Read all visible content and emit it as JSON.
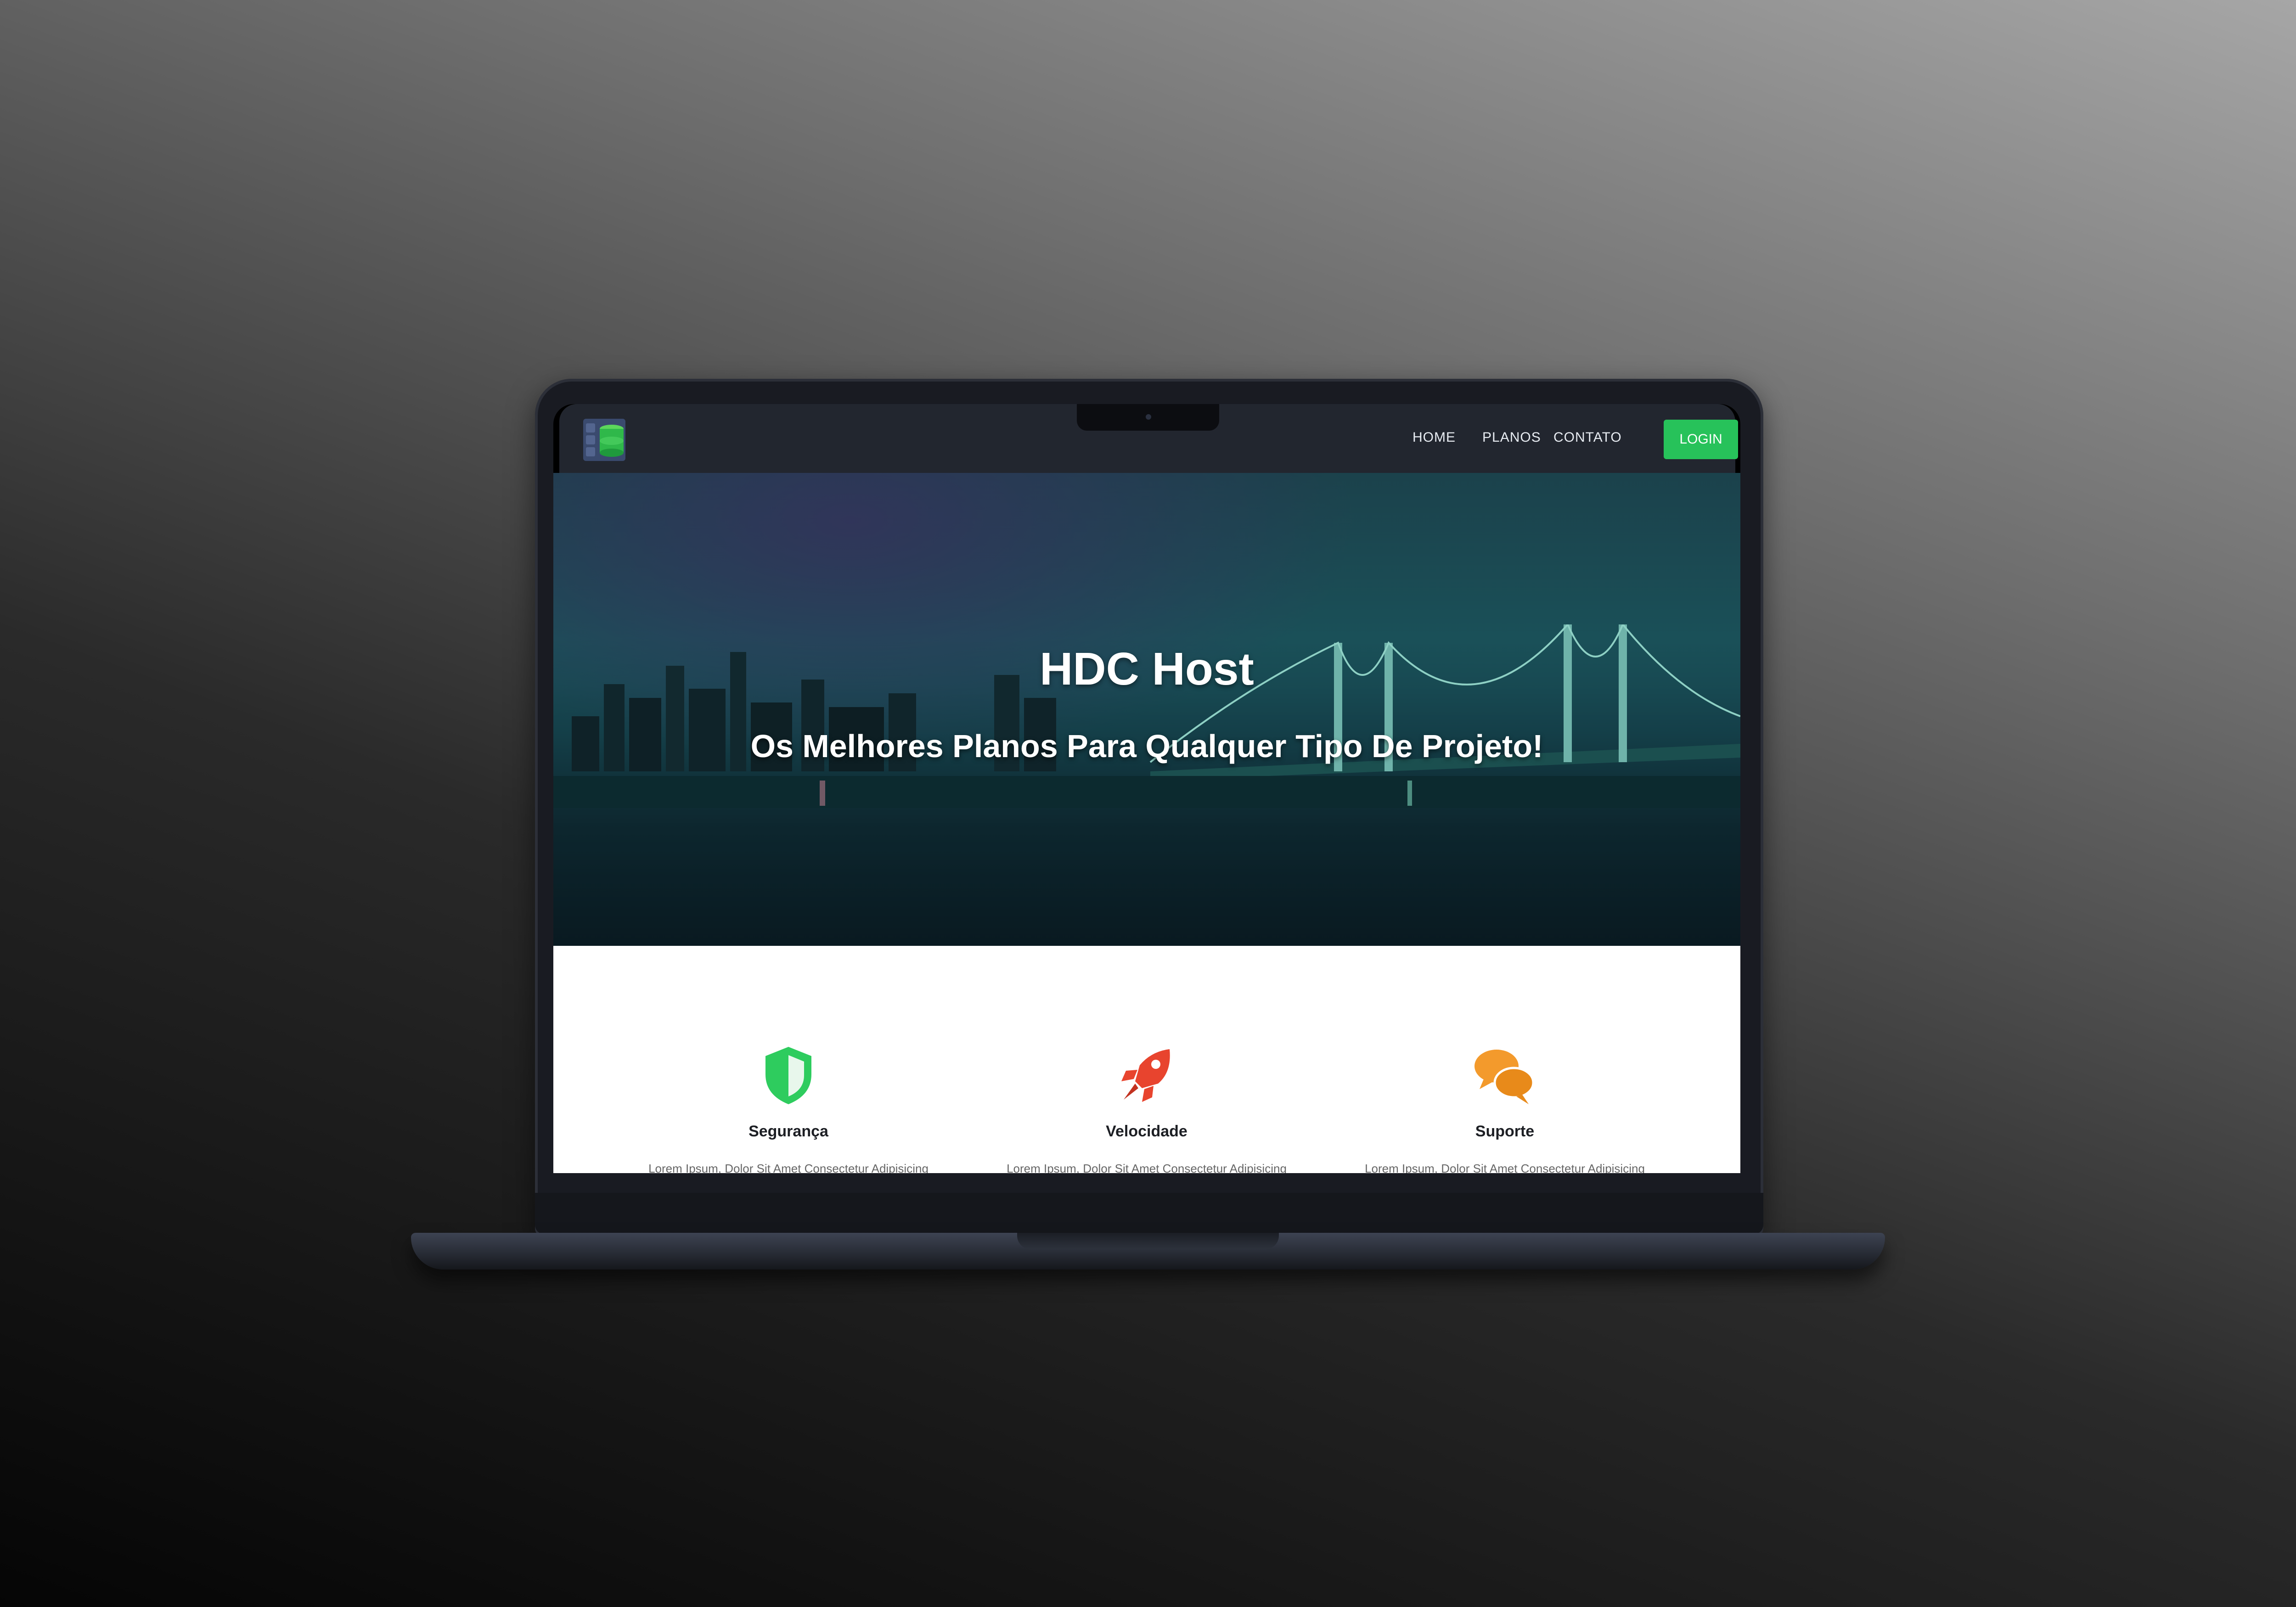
{
  "site": {
    "logo_icon": "server-database-icon",
    "nav": {
      "home": "HOME",
      "plans": "PLANOS",
      "contact": "CONTATO",
      "login": "LOGIN"
    },
    "hero": {
      "title": "HDC Host",
      "subtitle": "Os Melhores Planos Para Qualquer Tipo De Projeto!"
    },
    "features": [
      {
        "icon": "shield-icon",
        "title": "Segurança",
        "text": "Lorem Ipsum, Dolor Sit Amet Consectetur Adipisicing",
        "color": "#2ecc5e"
      },
      {
        "icon": "rocket-icon",
        "title": "Velocidade",
        "text": "Lorem Ipsum, Dolor Sit Amet Consectetur Adipisicing",
        "color": "#e8442e"
      },
      {
        "icon": "chat-bubbles-icon",
        "title": "Suporte",
        "text": "Lorem Ipsum, Dolor Sit Amet Consectetur Adipisicing",
        "color": "#f39a2c"
      }
    ]
  },
  "colors": {
    "accent_green": "#27c25a",
    "navbar_bg": "#22262f",
    "hero_teal": "#1d5a62"
  }
}
